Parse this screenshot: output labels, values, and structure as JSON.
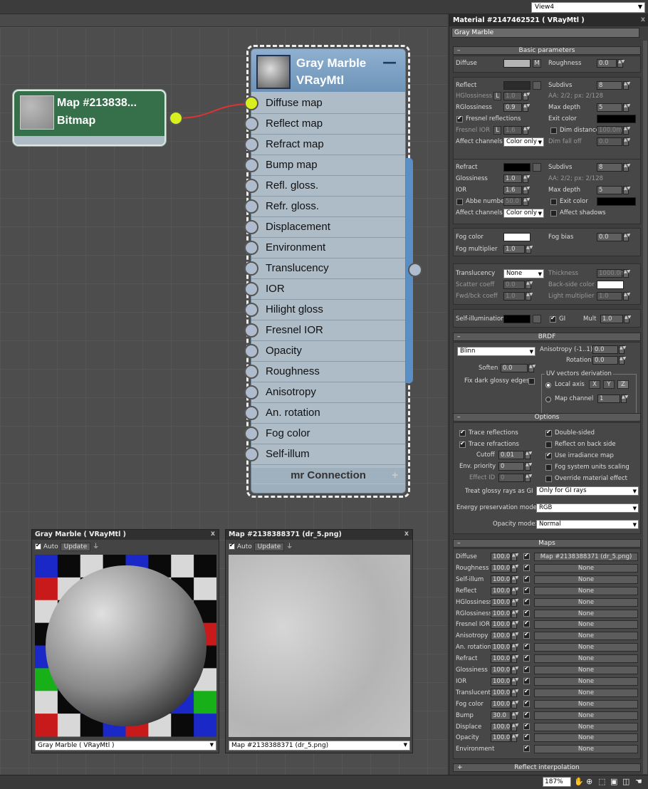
{
  "viewport": {
    "selector_value": "View4"
  },
  "nodes": {
    "bitmap": {
      "title": "Map  #213838...",
      "type": "Bitmap"
    },
    "vray": {
      "title": "Gray Marble",
      "type": "VRayMtl",
      "slots": [
        "Diffuse map",
        "Reflect map",
        "Refract map",
        "Bump map",
        "Refl. gloss.",
        "Refr. gloss.",
        "Displacement",
        "Environment",
        "Translucency",
        "IOR",
        "Hilight gloss",
        "Fresnel IOR",
        "Opacity",
        "Roughness",
        "Anisotropy",
        "An. rotation",
        "Fog color",
        "Self-illum"
      ],
      "mr_connection": "mr Connection"
    }
  },
  "preview1": {
    "title": "Gray Marble   ( VRayMtl )",
    "auto": "Auto",
    "update": "Update",
    "select": "Gray Marble   ( VRayMtl )"
  },
  "preview2": {
    "title": "Map #2138388371 (dr_5.png)",
    "auto": "Auto",
    "update": "Update",
    "select": "Map #2138388371 (dr_5.png)"
  },
  "panel": {
    "title": "Material #2147462521  ( VRayMtl )",
    "name": "Gray Marble",
    "basic": {
      "header": "Basic parameters",
      "diffuse": "Diffuse",
      "m": "M",
      "roughness": "Roughness",
      "roughness_val": "0.0",
      "reflect": "Reflect",
      "subdivs": "Subdivs",
      "subdivs_val": "8",
      "hgloss": "HGlossiness",
      "l": "L",
      "hgloss_val": "1.0",
      "aa": "AA: 2/2; px: 2/128",
      "rgloss": "RGlossiness",
      "rgloss_val": "0.9",
      "maxdepth": "Max depth",
      "maxdepth_val": "5",
      "fresnel": "Fresnel reflections",
      "exit": "Exit color",
      "fior": "Fresnel IOR",
      "fior_val": "1.6",
      "dimdist": "Dim distance",
      "dimdist_val": "100.0m",
      "affect": "Affect channels",
      "affect_val": "Color only",
      "dimfall": "Dim fall off",
      "dimfall_val": "0.0",
      "refract": "Refract",
      "r_subdivs_val": "8",
      "gloss": "Glossiness",
      "gloss_val": "1.0",
      "r_aa": "AA: 2/2; px: 2/128",
      "ior": "IOR",
      "ior_val": "1.6",
      "r_maxdepth_val": "5",
      "abbe": "Abbe number",
      "abbe_val": "50.0",
      "r_exit": "Exit color",
      "r_affect_val": "Color only",
      "shadows": "Affect shadows",
      "fogcolor": "Fog color",
      "fogbias": "Fog bias",
      "fogbias_val": "0.0",
      "fogmult": "Fog multiplier",
      "fogmult_val": "1.0",
      "transl": "Translucency",
      "transl_val": "None",
      "thick": "Thickness",
      "thick_val": "1000.0m",
      "scatter": "Scatter coeff",
      "scatter_val": "0.0",
      "backside": "Back-side color",
      "fwd": "Fwd/bck coeff",
      "fwd_val": "1.0",
      "lightmult": "Light multiplier",
      "lightmult_val": "1.0",
      "selfillum": "Self-illumination",
      "gi": "GI",
      "mult": "Mult",
      "mult_val": "1.0"
    },
    "brdf": {
      "header": "BRDF",
      "type": "Blinn",
      "aniso": "Anisotropy (-1..1)",
      "aniso_val": "0.0",
      "rotation": "Rotation",
      "rotation_val": "0.0",
      "soften": "Soften",
      "soften_val": "0.0",
      "fixdark": "Fix dark glossy edges",
      "uv": "UV vectors derivation",
      "local": "Local axis",
      "x": "X",
      "y": "Y",
      "z": "Z",
      "mapch": "Map channel",
      "mapch_val": "1"
    },
    "options": {
      "header": "Options",
      "trace_refl": "Trace reflections",
      "double": "Double-sided",
      "trace_refr": "Trace refractions",
      "reflback": "Reflect on back side",
      "cutoff": "Cutoff",
      "cutoff_val": "0.01",
      "irr": "Use irradiance map",
      "envpri": "Env. priority",
      "envpri_val": "0",
      "fogunits": "Fog system units scaling",
      "effect": "Effect ID",
      "effect_val": "0",
      "override": "Override material effect",
      "glossy_gi": "Treat glossy rays as GI",
      "glossy_gi_val": "Only for GI rays",
      "energy": "Energy preservation mode:",
      "energy_val": "RGB",
      "opacity": "Opacity mode:",
      "opacity_val": "Normal"
    },
    "maps": {
      "header": "Maps",
      "rows": [
        {
          "name": "Diffuse",
          "amt": "100.0",
          "map": "Map #2138388371 (dr_5.png)"
        },
        {
          "name": "Roughness",
          "amt": "100.0",
          "map": "None"
        },
        {
          "name": "Self-illum",
          "amt": "100.0",
          "map": "None"
        },
        {
          "name": "Reflect",
          "amt": "100.0",
          "map": "None"
        },
        {
          "name": "HGlossiness",
          "amt": "100.0",
          "map": "None"
        },
        {
          "name": "RGlossiness",
          "amt": "100.0",
          "map": "None"
        },
        {
          "name": "Fresnel IOR",
          "amt": "100.0",
          "map": "None"
        },
        {
          "name": "Anisotropy",
          "amt": "100.0",
          "map": "None"
        },
        {
          "name": "An. rotation",
          "amt": "100.0",
          "map": "None"
        },
        {
          "name": "Refract",
          "amt": "100.0",
          "map": "None"
        },
        {
          "name": "Glossiness",
          "amt": "100.0",
          "map": "None"
        },
        {
          "name": "IOR",
          "amt": "100.0",
          "map": "None"
        },
        {
          "name": "Translucent",
          "amt": "100.0",
          "map": "None"
        },
        {
          "name": "Fog color",
          "amt": "100.0",
          "map": "None"
        },
        {
          "name": "Bump",
          "amt": "30.0",
          "map": "None"
        },
        {
          "name": "Displace",
          "amt": "100.0",
          "map": "None"
        },
        {
          "name": "Opacity",
          "amt": "100.0",
          "map": "None"
        },
        {
          "name": "Environment",
          "amt": "",
          "map": "None"
        }
      ]
    },
    "reflect_interp": "Reflect interpolation"
  },
  "statusbar": {
    "zoom": "187%"
  }
}
